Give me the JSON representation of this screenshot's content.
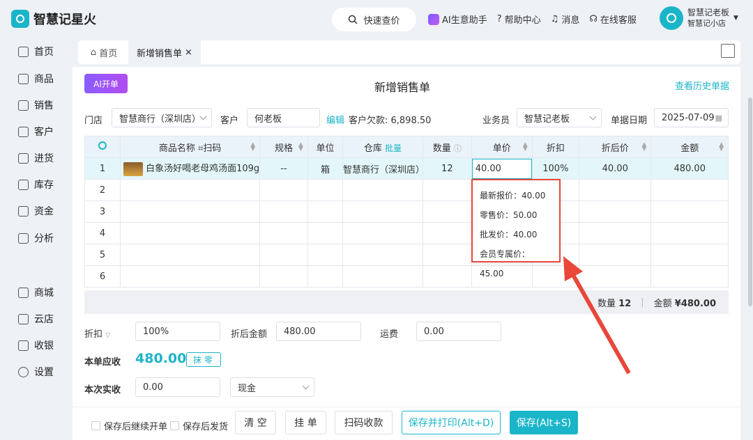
{
  "app": {
    "name": "智慧记星火"
  },
  "header": {
    "quick_search": "快速查价",
    "links": [
      "AI生意助手",
      "帮助中心",
      "消息",
      "在线客服"
    ],
    "user_name": "智慧记老板",
    "shop_name": "智慧记小店"
  },
  "sidebar": {
    "items": [
      "首页",
      "商品",
      "销售",
      "客户",
      "进货",
      "库存",
      "资金",
      "分析",
      "商城",
      "云店",
      "收银",
      "设置"
    ]
  },
  "tabs": {
    "home": "首页",
    "active": "新增销售单"
  },
  "form": {
    "ai_button": "AI开单",
    "title": "新增销售单",
    "history": "查看历史单据",
    "store_label": "门店",
    "store_value": "智慧商行（深圳店）",
    "customer_label": "客户",
    "customer_value": "何老板",
    "edit": "编辑",
    "debt": "客户欠款: 6,898.50",
    "salesperson_label": "业务员",
    "salesperson_value": "智慧记老板",
    "date_label": "单据日期",
    "date_value": "2025-07-09"
  },
  "table": {
    "headers": [
      "商品名称",
      "扫码",
      "规格",
      "单位",
      "仓库",
      "批量",
      "数量",
      "单价",
      "折扣",
      "折后价",
      "金额"
    ],
    "row1": {
      "index": "1",
      "name": "白象汤好喝老母鸡汤面109g",
      "spec": "--",
      "unit": "箱",
      "warehouse": "智慧商行（深圳店）",
      "qty": "12",
      "price": "40.00",
      "discount": "100%",
      "after": "40.00",
      "amount": "480.00"
    },
    "rows": [
      "2",
      "3",
      "4",
      "5",
      "6"
    ]
  },
  "summary": {
    "qty_label": "数量",
    "qty": "12",
    "amount_label": "金额",
    "amount": "¥480.00"
  },
  "popup": {
    "latest": "最新报价：40.00",
    "retail": "零售价：50.00",
    "wholesale": "批发价：40.00",
    "member": "会员专属价：45.00"
  },
  "payment": {
    "discount_label": "折扣",
    "discount": "100%",
    "after_label": "折后金额",
    "after": "480.00",
    "freight_label": "运费",
    "freight": "0.00",
    "due_label": "本单应收",
    "due": "480.00",
    "round_button": "抹 零",
    "paid_label": "本次实收",
    "paid": "0.00",
    "method": "现金"
  },
  "bottom": {
    "continue": "保存后继续开单",
    "ship": "保存后发货",
    "clear": "清 空",
    "hang": "挂 单",
    "scan": "扫码收款",
    "print": "保存并打印(Alt+D)",
    "save": "保存(Alt+S)"
  },
  "colors": {
    "accent": "#1bb5c9",
    "highlight": "#e8473a"
  }
}
